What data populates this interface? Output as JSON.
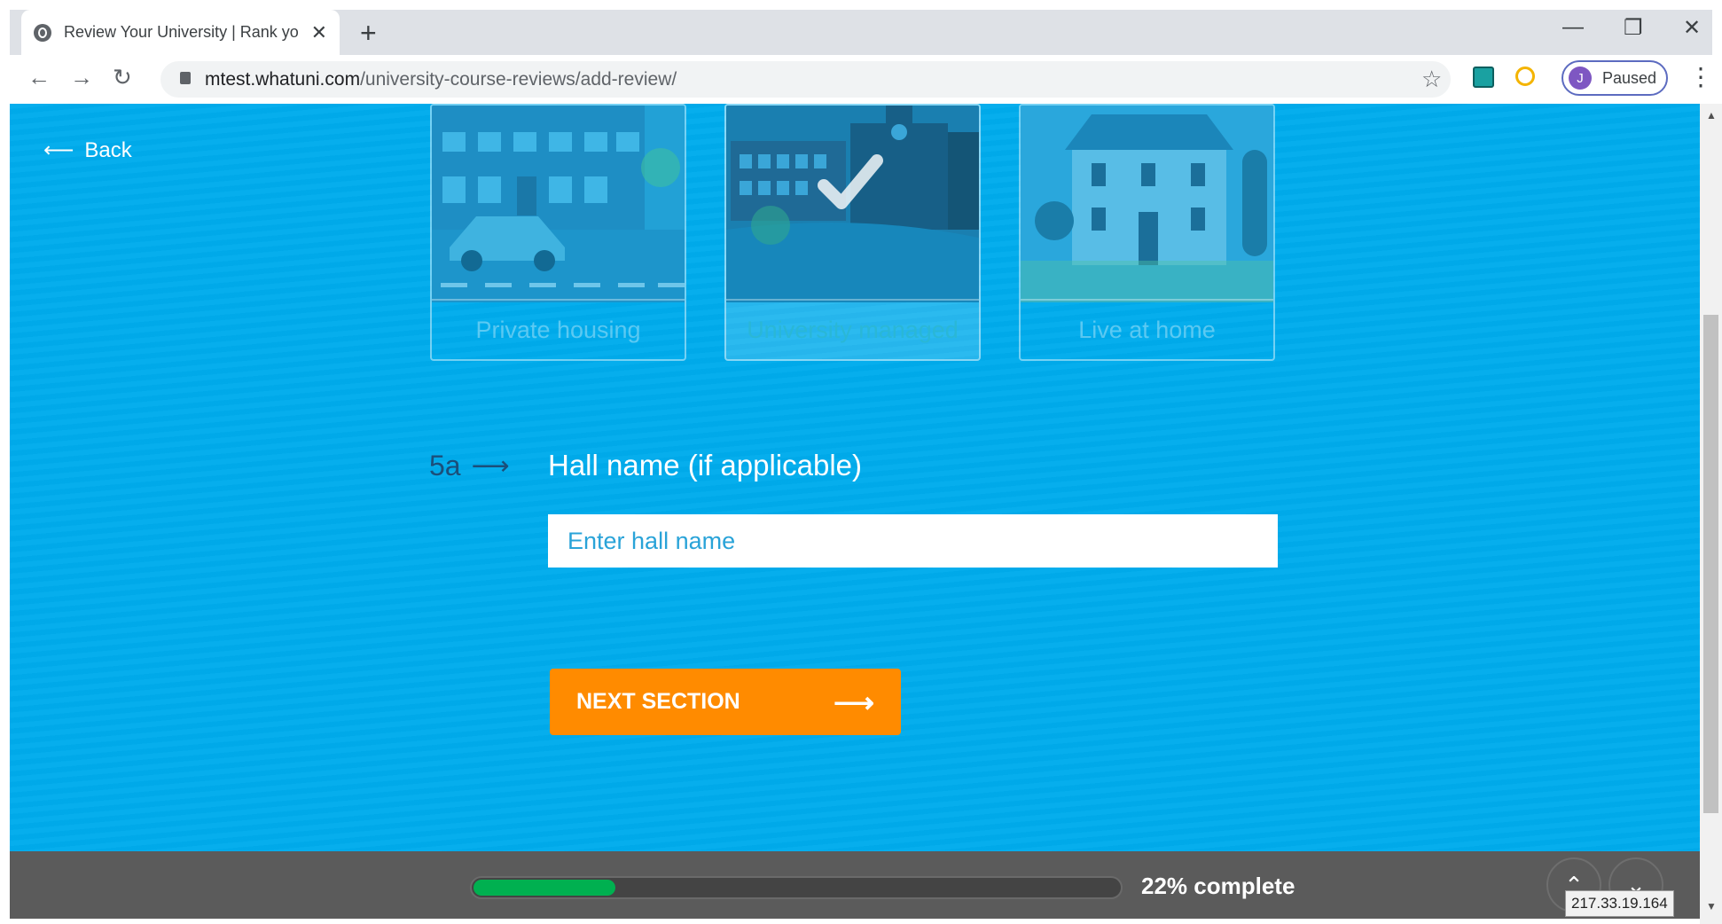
{
  "browser": {
    "tab_title": "Review Your University | Rank yo",
    "url_domain": "mtest.whatuni.com",
    "url_path": "/university-course-reviews/add-review/",
    "profile_initial": "J",
    "profile_status": "Paused"
  },
  "page": {
    "back_label": "Back",
    "accommodation_options": [
      {
        "label": "Private housing",
        "selected": false
      },
      {
        "label": "University managed",
        "selected": true
      },
      {
        "label": "Live at home",
        "selected": false
      }
    ],
    "question": {
      "number": "5a",
      "title": "Hall name (if applicable)",
      "placeholder": "Enter hall name",
      "value": ""
    },
    "next_button_label": "NEXT SECTION"
  },
  "progress": {
    "percent": 22,
    "label": "22% complete"
  },
  "status_ip": "217.33.19.164",
  "colors": {
    "page_bg": "#00aced",
    "button_bg": "#ff8b00",
    "progress_fill": "#00b050",
    "footer_bg": "#5b5b5b"
  }
}
